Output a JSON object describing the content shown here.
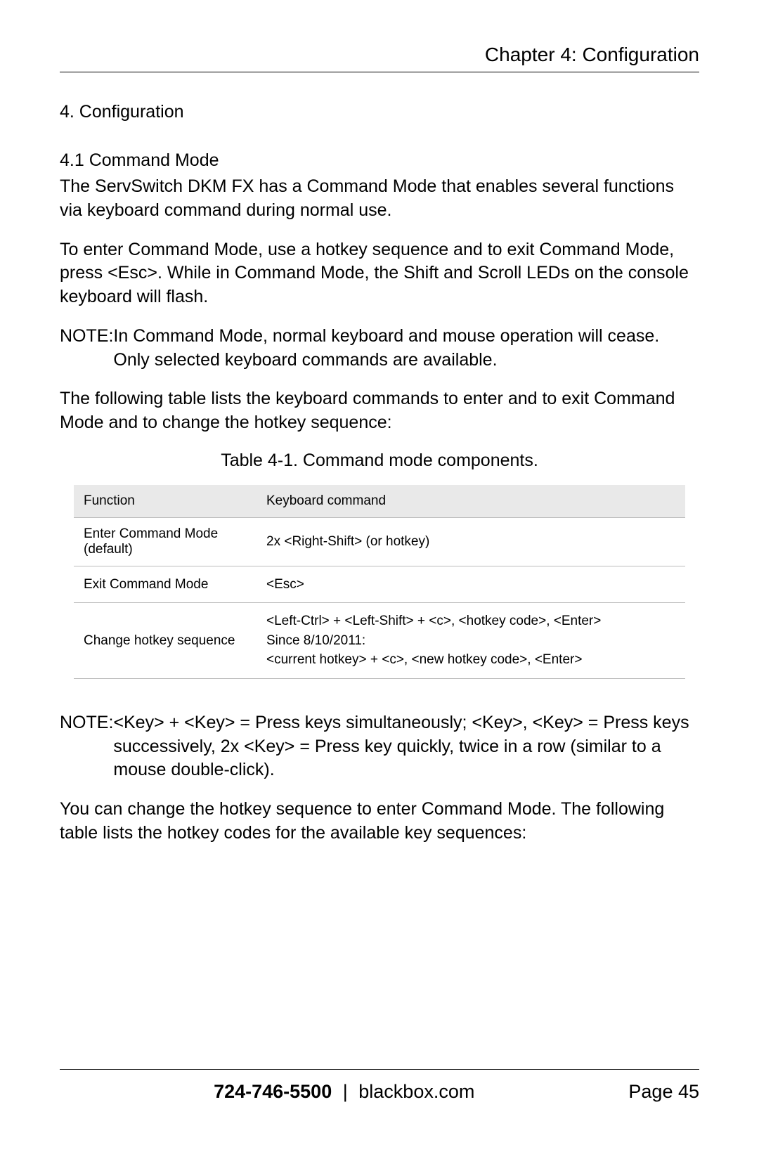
{
  "header": {
    "chapter": "Chapter 4: Configuration"
  },
  "section": {
    "title": "4. Configuration",
    "subtitle": "4.1 Command Mode"
  },
  "paragraphs": {
    "p1": "The ServSwitch DKM FX has a Command Mode that enables several functions via keyboard command during normal use.",
    "p2": "To enter Command Mode, use a hotkey sequence and to exit Command Mode, press <Esc>. While in Command Mode, the Shift and Scroll LEDs on the console keyboard will flash.",
    "note1_label": "NOTE:",
    "note1_text": "In Command Mode, normal keyboard and mouse operation will cease. Only selected keyboard commands are available.",
    "p3": "The following table lists the keyboard commands to enter and to exit Command Mode and to change the hotkey sequence:",
    "table_caption": "Table 4-1. Command mode components.",
    "note2_label": "NOTE:",
    "note2_text": "<Key> + <Key> = Press keys simultaneously; <Key>, <Key> = Press keys successively, 2x <Key> = Press key quickly, twice in a row (similar to a mouse double-click).",
    "p4": "You can change the hotkey sequence to enter Command Mode. The following table lists the hotkey codes for the available key sequences:"
  },
  "table": {
    "headers": {
      "c1": "Function",
      "c2": "Keyboard command"
    },
    "rows": [
      {
        "fn": "Enter Command Mode (default)",
        "cmd": "2x <Right-Shift> (or hotkey)"
      },
      {
        "fn": "Exit Command Mode",
        "cmd": "<Esc>"
      },
      {
        "fn": "Change hotkey sequence",
        "cmd": "<Left-Ctrl> + <Left-Shift> + <c>, <hotkey code>, <Enter>\nSince 8/10/2011:\n<current hotkey> + <c>, <new hotkey code>, <Enter>"
      }
    ]
  },
  "footer": {
    "phone": "724-746-5500",
    "separator": "|",
    "domain": "blackbox.com",
    "page": "Page 45"
  }
}
